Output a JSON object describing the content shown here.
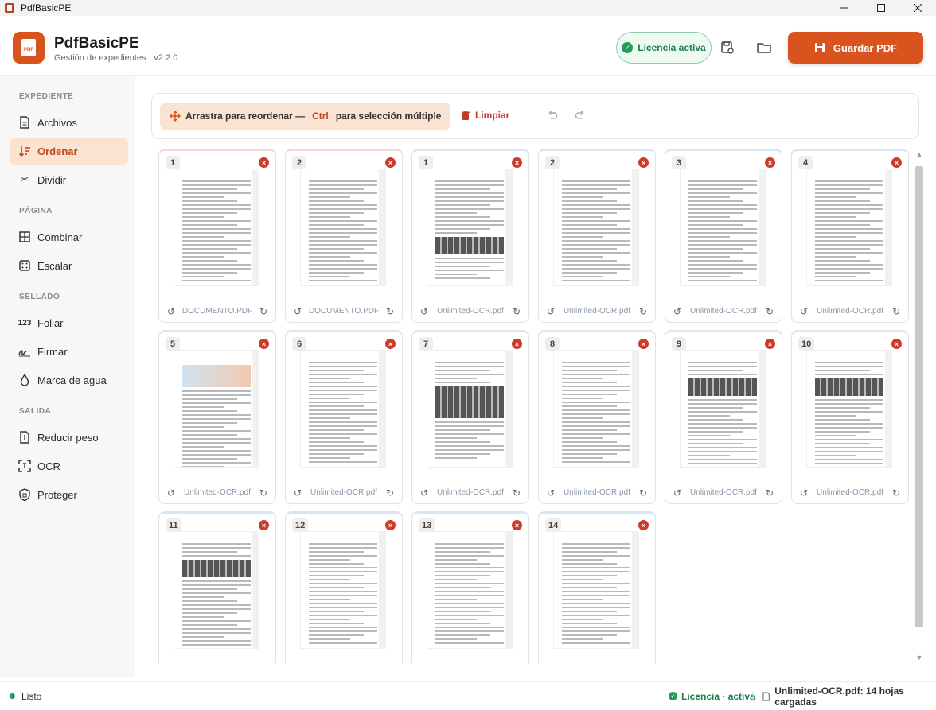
{
  "window": {
    "title": "PdfBasicPE"
  },
  "header": {
    "logo_text": "PDF",
    "app_name": "PdfBasicPE",
    "subtitle": "Gestión de expedientes · v2.2.0",
    "license_label": "Licencia activa",
    "save_label": "Guardar PDF"
  },
  "sidebar": {
    "sections": [
      {
        "label": "EXPEDIENTE",
        "items": [
          {
            "label": "Archivos",
            "icon": "file-icon"
          },
          {
            "label": "Ordenar",
            "icon": "reorder-icon",
            "active": true
          },
          {
            "label": "Dividir",
            "icon": "scissors-icon"
          }
        ]
      },
      {
        "label": "PÁGINA",
        "items": [
          {
            "label": "Combinar",
            "icon": "grid-icon"
          },
          {
            "label": "Escalar",
            "icon": "scale-icon"
          }
        ]
      },
      {
        "label": "SELLADO",
        "items": [
          {
            "label": "Foliar",
            "icon": "number-icon"
          },
          {
            "label": "Firmar",
            "icon": "signature-icon"
          },
          {
            "label": "Marca de agua",
            "icon": "drop-icon"
          }
        ]
      },
      {
        "label": "SALIDA",
        "items": [
          {
            "label": "Reducir peso",
            "icon": "compress-icon"
          },
          {
            "label": "OCR",
            "icon": "ocr-icon"
          },
          {
            "label": "Proteger",
            "icon": "shield-icon"
          }
        ]
      }
    ]
  },
  "toolbar": {
    "hint_before": "Arrastra para reordenar —",
    "hint_key": "Ctrl",
    "hint_after": "para selección múltiple",
    "clear_label": "Limpiar"
  },
  "pages": [
    {
      "num": "1",
      "file": "DOCUMENTO.PDF"
    },
    {
      "num": "2",
      "file": "DOCUMENTO.PDF"
    },
    {
      "num": "1",
      "file": "Unlimited-OCR.pdf"
    },
    {
      "num": "2",
      "file": "Unlimited-OCR.pdf"
    },
    {
      "num": "3",
      "file": "Unlimited-OCR.pdf"
    },
    {
      "num": "4",
      "file": "Unlimited-OCR.pdf"
    },
    {
      "num": "5",
      "file": "Unlimited-OCR.pdf"
    },
    {
      "num": "6",
      "file": "Unlimited-OCR.pdf"
    },
    {
      "num": "7",
      "file": "Unlimited-OCR.pdf"
    },
    {
      "num": "8",
      "file": "Unlimited-OCR.pdf"
    },
    {
      "num": "9",
      "file": "Unlimited-OCR.pdf"
    },
    {
      "num": "10",
      "file": "Unlimited-OCR.pdf"
    },
    {
      "num": "11",
      "file": ""
    },
    {
      "num": "12",
      "file": ""
    },
    {
      "num": "13",
      "file": ""
    },
    {
      "num": "14",
      "file": ""
    }
  ],
  "status": {
    "ready": "Listo",
    "license": "Licencia · activa",
    "file_info": "Unlimited-OCR.pdf: 14 hojas cargadas"
  }
}
